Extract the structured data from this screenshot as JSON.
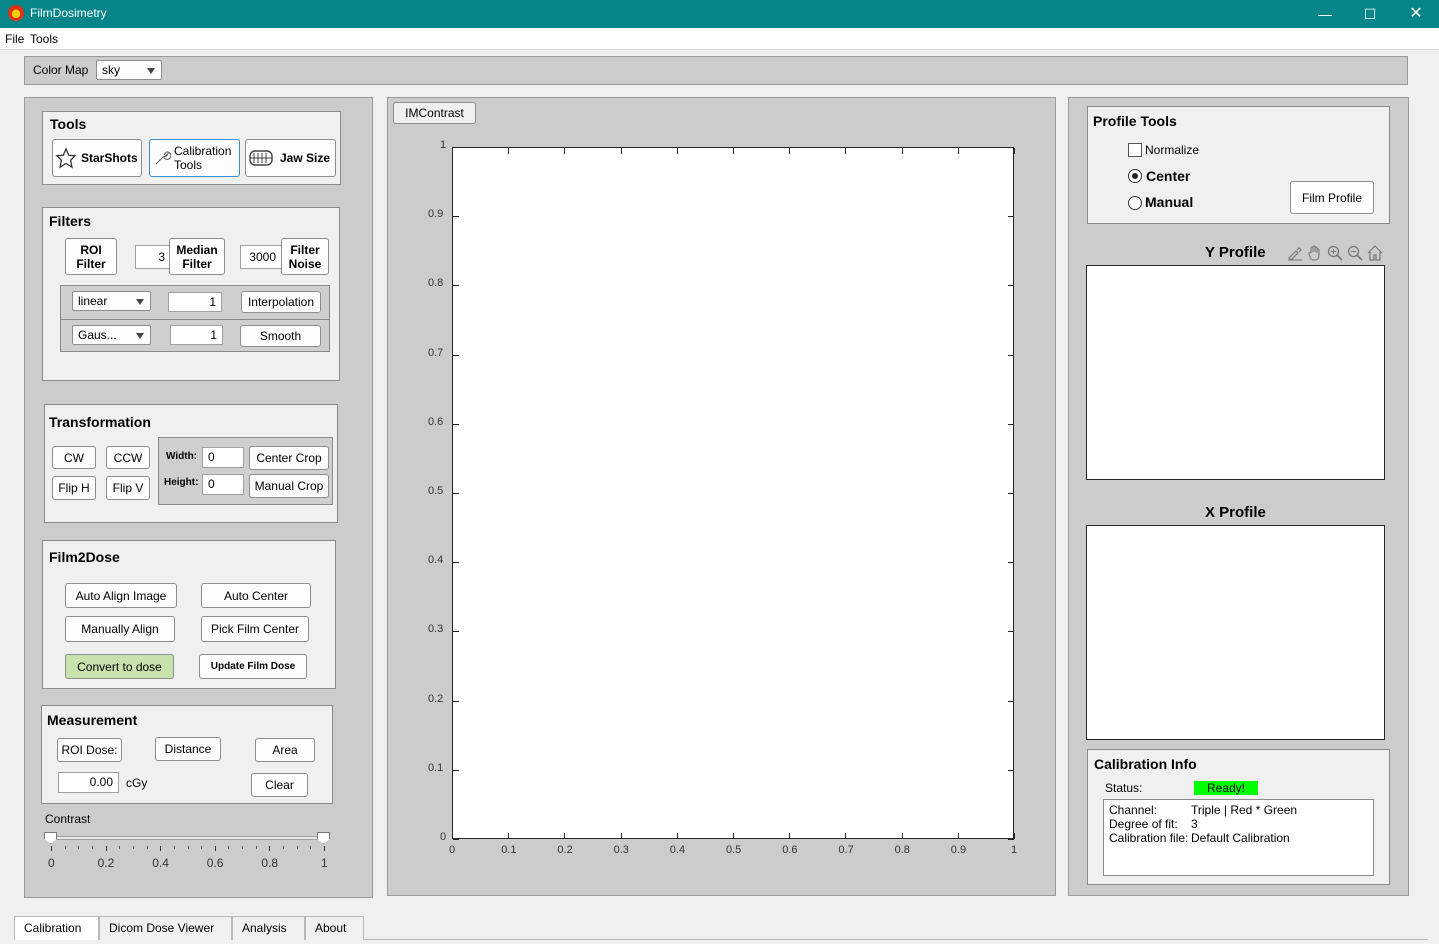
{
  "window": {
    "title": "FilmDosimetry"
  },
  "menu": {
    "items": [
      "File",
      "Tools"
    ]
  },
  "colormap": {
    "label": "Color Map",
    "value": "sky"
  },
  "tools": {
    "title": "Tools",
    "starshots": "StarShots",
    "calibration_line1": "Calibration",
    "calibration_line2": "Tools",
    "jawsize": "Jaw Size"
  },
  "filters": {
    "title": "Filters",
    "roi_line1": "ROI",
    "roi_line2": "Filter",
    "median_value": "3",
    "median_line1": "Median",
    "median_line2": "Filter",
    "noise_value": "3000",
    "noise_line1": "Filter",
    "noise_line2": "Noise",
    "interp_method": "linear",
    "interp_value": "1",
    "interp_label": "Interpolation",
    "smooth_method": "Gaus...",
    "smooth_value": "1",
    "smooth_label": "Smooth"
  },
  "transformation": {
    "title": "Transformation",
    "cw": "CW",
    "ccw": "CCW",
    "fliph": "Flip H",
    "flipv": "Flip V",
    "width_label": "Width:",
    "width_value": "0",
    "height_label": "Height:",
    "height_value": "0",
    "center_crop": "Center Crop",
    "manual_crop": "Manual Crop"
  },
  "film2dose": {
    "title": "Film2Dose",
    "auto_align": "Auto Align Image",
    "auto_center": "Auto Center",
    "manual_align": "Manually Align",
    "pick_center": "Pick Film Center",
    "convert": "Convert to dose",
    "update": "Update Film Dose"
  },
  "measurement": {
    "title": "Measurement",
    "roi_dose": "ROI Dose:",
    "distance": "Distance",
    "area": "Area",
    "value": "0.00",
    "unit": "cGy",
    "clear": "Clear"
  },
  "contrast": {
    "label": "Contrast",
    "ticks": [
      "0",
      "0.2",
      "0.4",
      "0.6",
      "0.8",
      "1"
    ],
    "low": 0,
    "high": 1
  },
  "main_axes": {
    "tab": "IMContrast",
    "xticks": [
      "0",
      "0.1",
      "0.2",
      "0.3",
      "0.4",
      "0.5",
      "0.6",
      "0.7",
      "0.8",
      "0.9",
      "1"
    ],
    "yticks": [
      "0",
      "0.1",
      "0.2",
      "0.3",
      "0.4",
      "0.5",
      "0.6",
      "0.7",
      "0.8",
      "0.9",
      "1"
    ]
  },
  "profile_tools": {
    "title": "Profile Tools",
    "normalize": "Normalize",
    "center": "Center",
    "manual": "Manual",
    "selected": "center",
    "film_profile": "Film Profile"
  },
  "y_profile": {
    "title": "Y Profile"
  },
  "x_profile": {
    "title": "X Profile"
  },
  "calibration_info": {
    "title": "Calibration Info",
    "status_label": "Status:",
    "status_value": "Ready!",
    "status_color": "#00ff00",
    "channel_label": "Channel:",
    "channel_value": "Triple | Red * Green",
    "degree_label": "Degree of fit:",
    "degree_value": "3",
    "file_label": "Calibration file:",
    "file_value": "Default Calibration"
  },
  "tabs": [
    "Calibration",
    "Dicom Dose Viewer",
    "Analysis",
    "About"
  ],
  "active_tab": "Calibration"
}
